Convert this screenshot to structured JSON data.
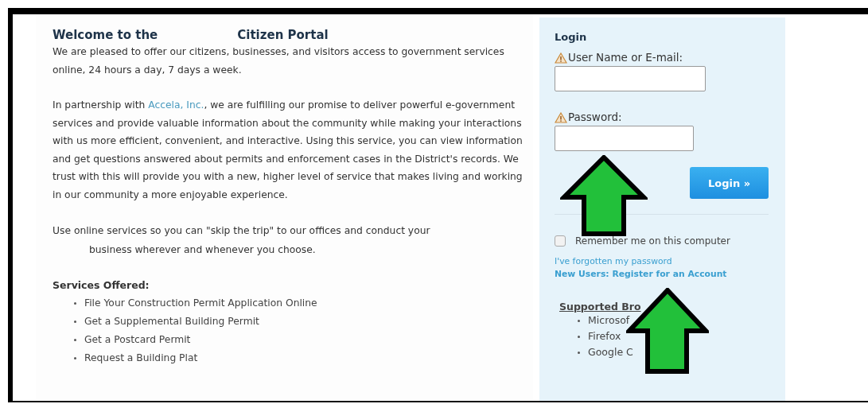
{
  "welcome": {
    "title_start": "Welcome to the",
    "title_end": "Citizen Portal",
    "intro": "We are pleased to offer our citizens, businesses, and visitors access to government services online, 24 hours a day, 7 days a week.",
    "partnership": {
      "before": "In partnership with ",
      "link": "Accela, Inc.",
      "after": ", we are fulfilling our promise to deliver powerful e-government services and provide valuable information about the community while making your interactions with us more efficient, convenient, and interactive. Using this service, you can view information and get questions answered about permits and enforcement cases in the District's records. We trust with this will provide you with a new, higher level of service that makes living and working in our community a more enjoyable experience."
    },
    "skip_line_1": "Use online services so you can \"skip the trip\" to our offices and conduct your",
    "skip_line_2": "business wherever and whenever you choose.",
    "services_heading": "Services Offered:",
    "services": [
      "File Your Construction Permit Application Online",
      "Get a Supplemental Building Permit",
      "Get a Postcard Permit",
      "Request a Building Plat"
    ]
  },
  "login": {
    "title": "Login",
    "username_label": "User Name or E-mail:",
    "password_label": "Password:",
    "button": "Login »",
    "remember": {
      "label": "Remember me on this computer",
      "checked": false
    },
    "forgot_link": "I've forgotten my password",
    "register_link": "New Users: Register for an Account",
    "browsers_heading": "Supported Bro",
    "browsers": [
      "Microsof",
      "Firefox",
      "Google C"
    ]
  }
}
